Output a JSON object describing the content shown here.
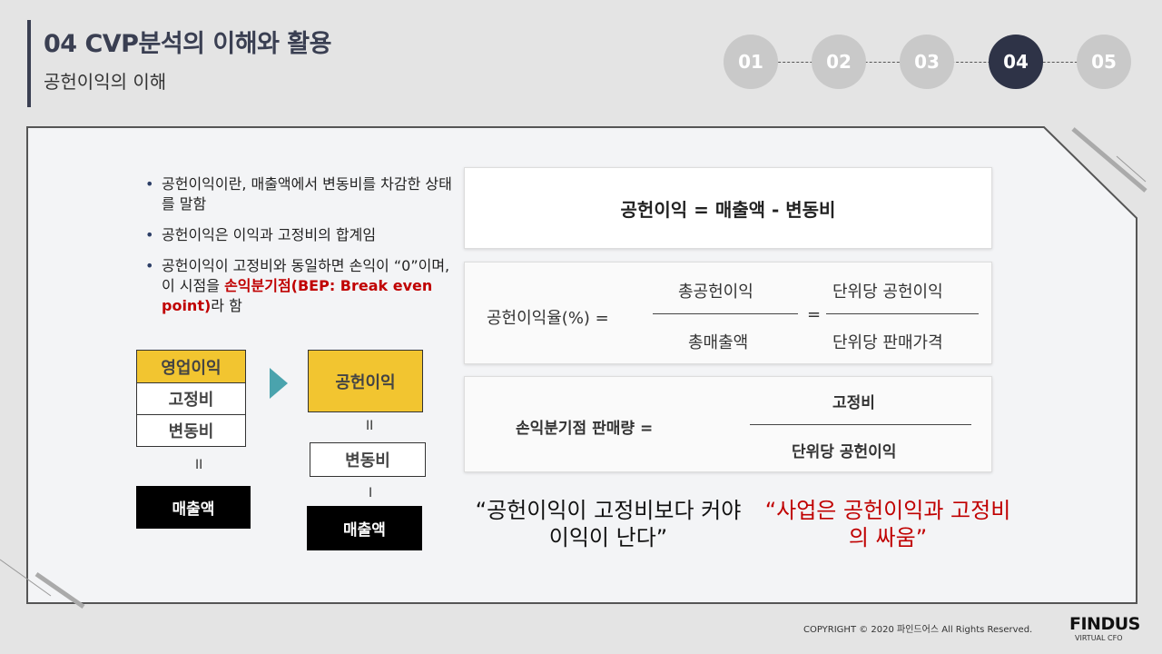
{
  "header": {
    "title": "04 CVP분석의 이해와 활용",
    "subtitle": "공헌이익의 이해"
  },
  "steps": [
    {
      "label": "01",
      "active": false
    },
    {
      "label": "02",
      "active": false
    },
    {
      "label": "03",
      "active": false
    },
    {
      "label": "04",
      "active": true
    },
    {
      "label": "05",
      "active": false
    }
  ],
  "bullets": {
    "b1": "공헌이익이란, 매출액에서 변동비를 차감한 상태를 말함",
    "b2": "공헌이익은 이익과 고정비의 합계임",
    "b3_pre": "공헌이익이 고정비와 동일하면 손익이 “0”이며, 이 시점을 ",
    "b3_red": "손익분기점(BEP: Break even point)",
    "b3_post": "라 함"
  },
  "diagram": {
    "left": {
      "op_profit": "영업이익",
      "fixed": "고정비",
      "variable": "변동비",
      "equals": "II",
      "sales": "매출액"
    },
    "right": {
      "contribution": "공헌이익",
      "equals": "II",
      "variable": "변동비",
      "minus": "I",
      "sales": "매출액"
    }
  },
  "formulas": {
    "f1": "공헌이익 = 매출액 - 변동비",
    "ratio_label": "공헌이익율(%)  =",
    "ratio_num": "총공헌이익",
    "ratio_den": "총매출액",
    "ratio_eq": "=",
    "unit_num": "단위당 공헌이익",
    "unit_den": "단위당 판매가격",
    "bep_label": "손익분기점 판매량 =",
    "bep_num": "고정비",
    "bep_den": "단위당 공헌이익"
  },
  "quotes": {
    "q1": "“공헌이익이 고정비보다 커야 이익이 난다”",
    "q2": "“사업은 공헌이익과 고정비의 싸움”"
  },
  "footer": {
    "copyright": "COPYRIGHT © 2020 파인드어스 All Rights Reserved.",
    "logo": "FINDUS",
    "logo_sub": "VIRTUAL CFO"
  },
  "colors": {
    "accent_dark": "#2e3347",
    "accent_red": "#c00000",
    "yellow": "#f2c530",
    "arrow_teal": "#4aa3ad"
  }
}
